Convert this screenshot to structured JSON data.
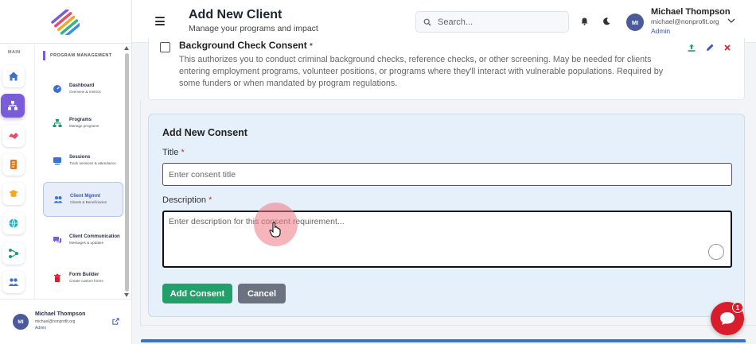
{
  "header": {
    "title": "Add New Client",
    "subtitle": "Manage your programs and impact",
    "search_placeholder": "Search...",
    "user": {
      "initials": "MI",
      "name": "Michael Thompson",
      "email": "michael@nonprofit.org",
      "role": "Admin"
    }
  },
  "sidebar": {
    "main_label": "MAIN",
    "section_title": "PROGRAM MANAGEMENT",
    "rail": [
      "home-icon",
      "sitemap-icon",
      "handshake-icon",
      "document-icon",
      "graduation-cap-icon",
      "globe-icon",
      "flow-icon",
      "people-icon"
    ],
    "items": [
      {
        "label": "Dashboard",
        "sub": "Overview & metrics",
        "icon": "dashboard-icon"
      },
      {
        "label": "Programs",
        "sub": "Manage programs",
        "icon": "sitemap-icon"
      },
      {
        "label": "Sessions",
        "sub": "Track sessions & attendance",
        "icon": "sessions-icon"
      },
      {
        "label": "Client Mgmnt",
        "sub": "Clients & Beneficiaries",
        "icon": "users-icon",
        "active": true
      },
      {
        "label": "Client Communication",
        "sub": "Messages & updates",
        "icon": "chat-icon"
      },
      {
        "label": "Form Builder",
        "sub": "Create custom forms",
        "icon": "trash-icon"
      }
    ],
    "user": {
      "initials": "MI",
      "name": "Michael Thompson",
      "email": "michael@nonprofit.org",
      "role": "Admin"
    }
  },
  "consent": {
    "title": "Background Check Consent",
    "required_mark": "*",
    "description": "This authorizes you to conduct criminal background checks, reference checks, or other screening. May be needed for clients entering employment programs, volunteer positions, or programs where they'll interact with vulnerable populations. Required by some funders or when mandated by program regulations."
  },
  "add_consent": {
    "heading": "Add New Consent",
    "title_label": "Title",
    "title_placeholder": "Enter consent title",
    "description_label": "Description",
    "description_placeholder": "Enter description for this consent requirement...",
    "required_star": "*",
    "add_button": "Add Consent",
    "cancel_button": "Cancel"
  },
  "chat": {
    "badge": "1"
  },
  "colors": {
    "accent": "#7a5cd6",
    "primary_blue": "#3558b8",
    "success": "#22a06b",
    "danger": "#d81d2c",
    "panel": "#e6f0fa"
  }
}
